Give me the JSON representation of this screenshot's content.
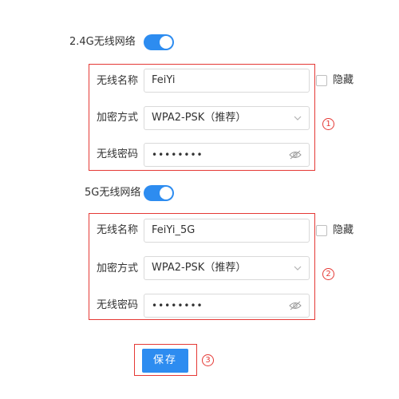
{
  "section_24g": {
    "title": "2.4G无线网络",
    "enabled": true,
    "ssid_label": "无线名称",
    "ssid_value": "FeiYi",
    "hide_label": "隐藏",
    "encryption_label": "加密方式",
    "encryption_value": "WPA2-PSK（推荐）",
    "password_label": "无线密码",
    "password_value": "••••••••",
    "marker": "1"
  },
  "section_5g": {
    "title": "5G无线网络",
    "enabled": true,
    "ssid_label": "无线名称",
    "ssid_value": "FeiYi_5G",
    "hide_label": "隐藏",
    "encryption_label": "加密方式",
    "encryption_value": "WPA2-PSK（推荐）",
    "password_label": "无线密码",
    "password_value": "••••••••",
    "marker": "2"
  },
  "save": {
    "label": "保存",
    "marker": "3"
  },
  "colors": {
    "accent": "#2d8cf0",
    "highlight": "#e53935"
  },
  "icons": {
    "toggle": "switch-on",
    "dropdown": "chevron-down-icon",
    "password_visibility": "eye-off-icon"
  }
}
